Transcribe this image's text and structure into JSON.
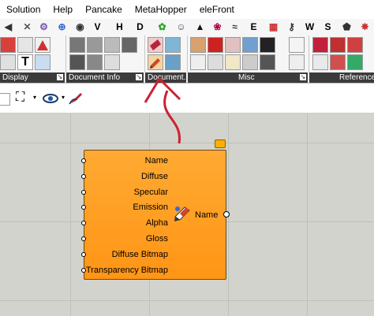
{
  "menu": [
    "Solution",
    "Help",
    "Pancake",
    "MetaHopper",
    "eleFront"
  ],
  "tabs": [
    "V",
    "H",
    "D",
    "E",
    "W",
    "S"
  ],
  "ribbon_groups": [
    "Display",
    "Document Info",
    "Document...",
    "Misc",
    "Reference"
  ],
  "component": {
    "inputs": [
      "Name",
      "Diffuse",
      "Specular",
      "Emission",
      "Alpha",
      "Gloss",
      "Diffuse Bitmap",
      "Transparency Bitmap"
    ],
    "output": "Name"
  },
  "colors": {
    "accent_arrow": "#cc2233",
    "component_fill": "#ff9a20",
    "ribbon_label_bg": "#3b3b3b"
  },
  "icons": [
    "zoom-extents-icon",
    "eye-icon",
    "pen-icon",
    "material-icon"
  ]
}
